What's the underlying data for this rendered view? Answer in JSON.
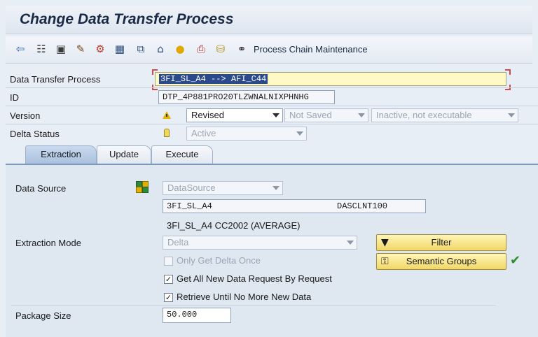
{
  "window": {
    "title": "Change Data Transfer Process"
  },
  "toolbar": {
    "icons": [
      "back-icon",
      "hierarchy-icon",
      "display-icon",
      "edit-pencil-icon",
      "activate-icon",
      "check-icon",
      "copy-icon",
      "transport-icon",
      "info-icon",
      "print-icon",
      "database-icon",
      "process-chain-icon"
    ],
    "process_chain_label": "Process Chain Maintenance"
  },
  "header": {
    "dtp_label": "Data Transfer Process",
    "dtp_value_selected": "3FI_SL_A4 --> AFI_C44",
    "id_label": "ID",
    "id_value": "DTP_4P881PRO20TLZWNALNIXPHNHG",
    "version_label": "Version",
    "version_value": "Revised",
    "save_status": "Not Saved",
    "exec_status": "Inactive, not executable",
    "delta_label": "Delta Status",
    "delta_value": "Active"
  },
  "tabs": [
    {
      "label": "Extraction",
      "active": true
    },
    {
      "label": "Update",
      "active": false
    },
    {
      "label": "Execute",
      "active": false
    }
  ],
  "extraction": {
    "data_source_label": "Data Source",
    "data_source_type": "DataSource",
    "source_name": "3FI_SL_A4",
    "source_system": "DASCLNT100",
    "source_description": "3FI_SL_A4 CC2002 (AVERAGE)",
    "extraction_mode_label": "Extraction Mode",
    "extraction_mode_value": "Delta",
    "only_delta_once_label": "Only Get Delta Once",
    "get_all_new_label": "Get All New Data Request By Request",
    "retrieve_until_label": "Retrieve Until No More New Data",
    "package_size_label": "Package Size",
    "package_size_value": "50.000",
    "filter_button": "Filter",
    "semantic_groups_button": "Semantic Groups"
  },
  "colors": {
    "selection": "#2b4a8c",
    "button": "#f1d866",
    "active_tab": "#aac1de",
    "check": "#2f8f2f"
  }
}
